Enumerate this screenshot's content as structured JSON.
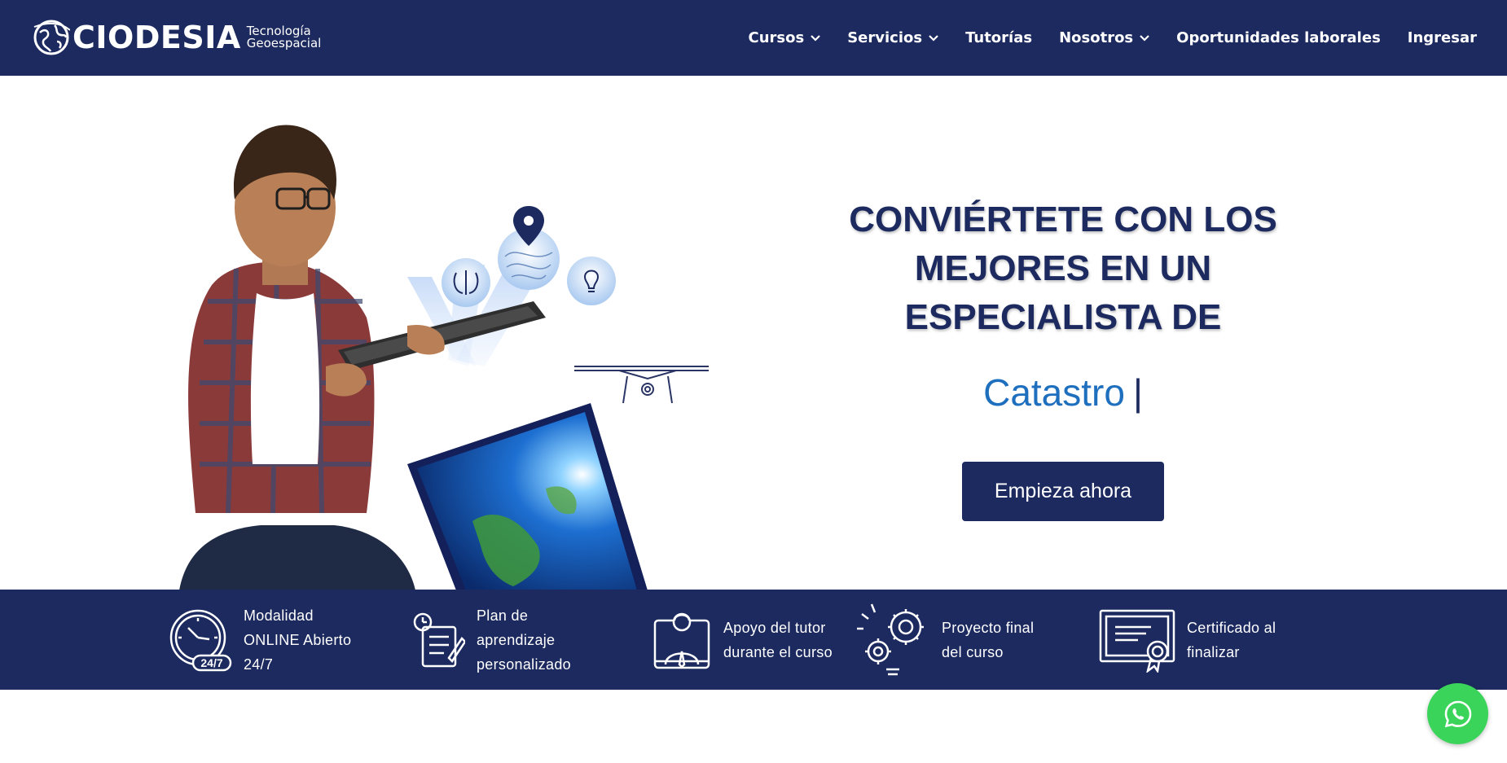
{
  "header": {
    "logo": {
      "word": "CIODESIA",
      "sub_line1": "Tecnología",
      "sub_line2": "Geoespacial"
    },
    "nav": [
      {
        "label": "Cursos",
        "has_dropdown": true
      },
      {
        "label": "Servicios",
        "has_dropdown": true
      },
      {
        "label": "Tutorías",
        "has_dropdown": false
      },
      {
        "label": "Nosotros",
        "has_dropdown": true
      },
      {
        "label": "Oportunidades laborales",
        "has_dropdown": false
      },
      {
        "label": "Ingresar",
        "has_dropdown": false
      }
    ]
  },
  "hero": {
    "headline": {
      "line1": "CONVIÉRTETE CON LOS",
      "line2_bold": "MEJORES",
      "line2_rest": " EN UN",
      "line3_bold": "ESPECIALISTA",
      "line3_rest": " DE"
    },
    "typed_text": "Catastro",
    "typed_cursor": "|",
    "cta_label": "Empieza ahora"
  },
  "features": [
    {
      "icon": "clock-24-7-icon",
      "lines": [
        "Modalidad",
        "ONLINE Abierto",
        "24/7"
      ]
    },
    {
      "icon": "study-plan-icon",
      "lines": [
        "Plan de",
        "aprendizaje",
        "personalizado"
      ]
    },
    {
      "icon": "tutor-icon",
      "lines": [
        "Apoyo del tutor",
        "durante el curso"
      ]
    },
    {
      "icon": "project-gears-icon",
      "lines": [
        "Proyecto final",
        "del curso"
      ]
    },
    {
      "icon": "certificate-icon",
      "lines": [
        "Certificado al",
        "finalizar"
      ]
    }
  ],
  "colors": {
    "brand_navy": "#1c2a5f",
    "accent_blue": "#1f6fbf",
    "whatsapp_green": "#3bd45a"
  },
  "floating": {
    "icon": "whatsapp-icon"
  }
}
